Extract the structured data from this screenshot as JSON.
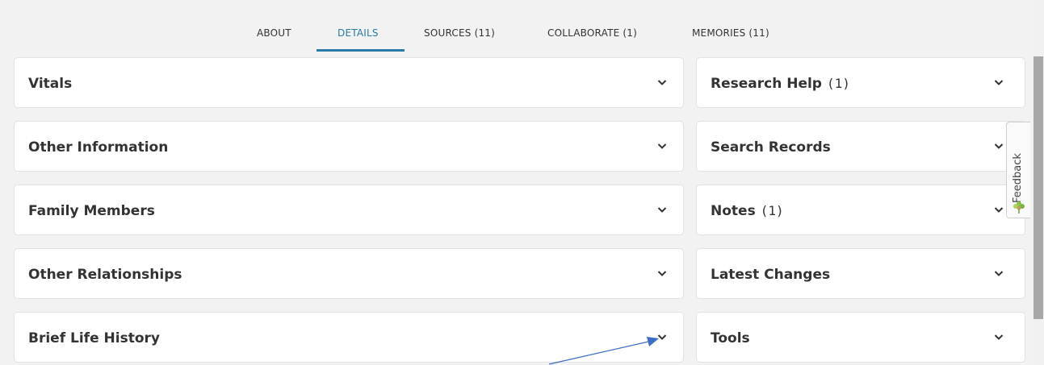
{
  "tabs": [
    {
      "label": "ABOUT",
      "active": false
    },
    {
      "label": "DETAILS",
      "active": true
    },
    {
      "label": "SOURCES (11)",
      "active": false
    },
    {
      "label": "COLLABORATE (1)",
      "active": false
    },
    {
      "label": "MEMORIES (11)",
      "active": false
    }
  ],
  "left_sections": [
    {
      "title": "Vitals"
    },
    {
      "title": "Other Information"
    },
    {
      "title": "Family Members"
    },
    {
      "title": "Other Relationships"
    },
    {
      "title": "Brief Life History"
    }
  ],
  "right_sections": [
    {
      "title": "Research Help",
      "count": "(1)"
    },
    {
      "title": "Search Records",
      "count": ""
    },
    {
      "title": "Notes",
      "count": "(1)"
    },
    {
      "title": "Latest Changes",
      "count": ""
    },
    {
      "title": "Tools",
      "count": ""
    }
  ],
  "feedback": {
    "label": "Feedback"
  },
  "colors": {
    "accent": "#2a7aa8",
    "background": "#f2f2f2",
    "card": "#ffffff",
    "arrow": "#3d6ec4"
  },
  "icons": {
    "chevron": "chevron-down-icon",
    "feedback": "feedback-flower-icon"
  }
}
